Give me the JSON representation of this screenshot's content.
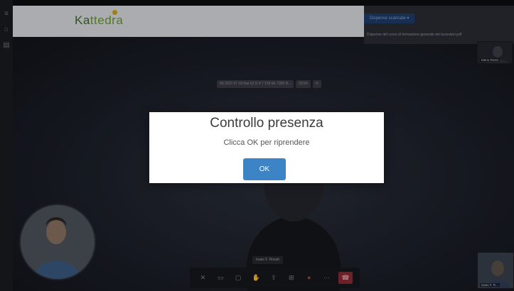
{
  "app": {
    "logo_part1": "Ka",
    "logo_part2": "ttedra"
  },
  "sidebar": {
    "icons": [
      "menu-icon",
      "home-icon",
      "document-icon"
    ]
  },
  "header": {
    "meeting_id": "68 2022 07 18 thai 62 D 4 7 218 Ek 7350 R...",
    "timer": "03:54",
    "extra_chip": "⟳"
  },
  "dispense": {
    "button_label": "Dispense scaricate",
    "item_label": "Dispense del corso di formazione generale dei lavoratori.pdf"
  },
  "participants": {
    "top_right_label": "Mario Rossi",
    "bottom_right_label": "Isaac F. R..."
  },
  "main_video": {
    "speaker_label": "Isaac F. Rosati"
  },
  "toolbar": {
    "icons": [
      "mic-off-icon",
      "camera-icon",
      "chat-icon",
      "hand-icon",
      "share-icon",
      "grid-icon",
      "record-icon",
      "more-icon",
      "hangup-icon"
    ]
  },
  "modal": {
    "title": "Controllo presenza",
    "message": "Clicca OK per riprendere",
    "ok_label": "OK"
  },
  "colors": {
    "ok_button": "#3d84c6",
    "hangup": "#8d2a33",
    "record": "#b23a4a"
  }
}
